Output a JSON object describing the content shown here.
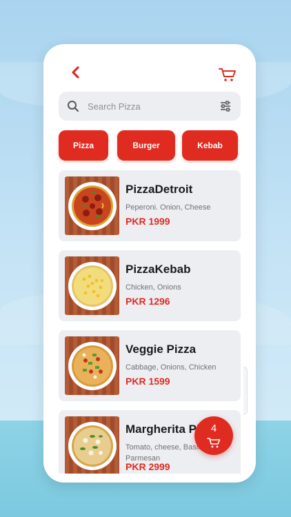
{
  "header": {
    "back_icon": "chevron-left-icon",
    "cart_icon": "cart-icon",
    "accent": "#e02b20"
  },
  "search": {
    "placeholder": "Search Pizza",
    "value": "",
    "search_icon": "search-icon",
    "filter_icon": "filter-sliders-icon"
  },
  "categories": [
    "Pizza",
    "Burger",
    "Kebab"
  ],
  "products": [
    {
      "name": "PizzaDetroit",
      "description": "Peperoni. Onion, Cheese",
      "price": "PKR 1999"
    },
    {
      "name": "PizzaKebab",
      "description": "Chicken, Onions",
      "price": "PKR 1296"
    },
    {
      "name": "Veggie Pizza",
      "description": "Cabbage, Onions, Chicken",
      "price": "PKR 1599"
    },
    {
      "name": "Margherita Pizza",
      "description": "Tomato, cheese, Basil, Parmesan",
      "price": "PKR 2999"
    }
  ],
  "cart_fab": {
    "count": "4",
    "icon": "cart-icon"
  },
  "colors": {
    "accent": "#e02b20",
    "card_bg": "#eceef2",
    "background": "#b9dcf1"
  }
}
